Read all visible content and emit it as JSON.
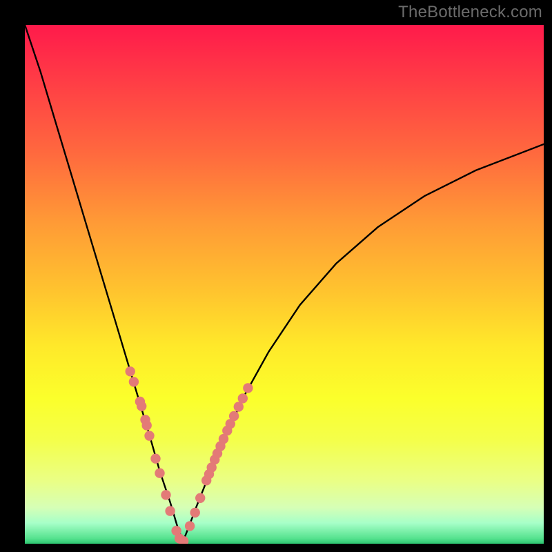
{
  "watermark": {
    "text": "TheBottleneck.com"
  },
  "gradient": {
    "stops": [
      "#ff1a4b",
      "#ff3a46",
      "#ff6a3e",
      "#ff9a36",
      "#ffc62e",
      "#ffe92a",
      "#fbff2b",
      "#f4ff4a",
      "#eaff86",
      "#d6ffb6",
      "#a7ffc8",
      "#55e28e",
      "#2cc46f"
    ]
  },
  "curve": {
    "color": "#000000",
    "width": 2.4,
    "minimum_x_frac": 0.305
  },
  "markers": {
    "color": "#e37a77",
    "radius": 7.2
  },
  "chart_data": {
    "type": "line",
    "title": "",
    "xlabel": "",
    "ylabel": "",
    "xlim": [
      0,
      1
    ],
    "ylim": [
      0,
      1
    ],
    "note": "x and y are normalized fractions of the plot area (0 = left/top edge, 1 = right/bottom edge). The black curve dips to the bottom near x≈0.305 then rises to the right. Salmon markers are clustered along the curve near the minimum.",
    "series": [
      {
        "name": "curve",
        "x": [
          0.0,
          0.03,
          0.06,
          0.09,
          0.12,
          0.15,
          0.18,
          0.21,
          0.24,
          0.26,
          0.28,
          0.295,
          0.305,
          0.315,
          0.33,
          0.35,
          0.38,
          0.42,
          0.47,
          0.53,
          0.6,
          0.68,
          0.77,
          0.87,
          1.0
        ],
        "y": [
          0.0,
          0.09,
          0.19,
          0.29,
          0.39,
          0.49,
          0.59,
          0.69,
          0.79,
          0.86,
          0.92,
          0.97,
          0.995,
          0.97,
          0.93,
          0.88,
          0.81,
          0.72,
          0.63,
          0.54,
          0.46,
          0.39,
          0.33,
          0.28,
          0.23
        ]
      },
      {
        "name": "markers",
        "x": [
          0.203,
          0.21,
          0.222,
          0.225,
          0.232,
          0.235,
          0.24,
          0.252,
          0.26,
          0.272,
          0.28,
          0.292,
          0.298,
          0.306,
          0.318,
          0.328,
          0.338,
          0.35,
          0.355,
          0.36,
          0.366,
          0.371,
          0.377,
          0.383,
          0.39,
          0.396,
          0.403,
          0.412,
          0.42,
          0.43
        ],
        "y": [
          0.668,
          0.688,
          0.726,
          0.735,
          0.761,
          0.772,
          0.792,
          0.836,
          0.864,
          0.906,
          0.937,
          0.975,
          0.99,
          0.995,
          0.966,
          0.94,
          0.912,
          0.878,
          0.866,
          0.853,
          0.838,
          0.826,
          0.812,
          0.798,
          0.782,
          0.769,
          0.754,
          0.736,
          0.72,
          0.7
        ]
      }
    ]
  }
}
